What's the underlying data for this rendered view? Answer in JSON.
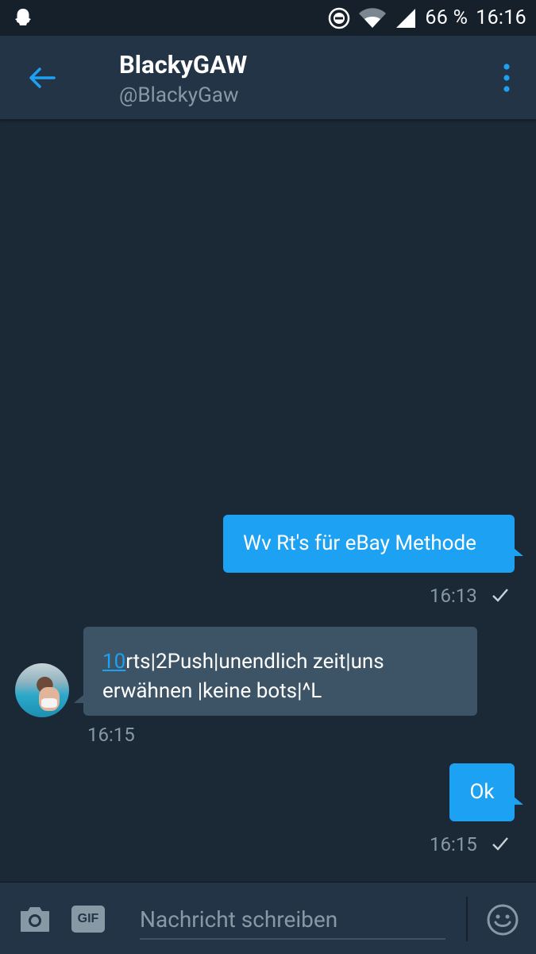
{
  "status_bar": {
    "battery": "66 %",
    "clock": "16:16"
  },
  "header": {
    "name": "BlackyGAW",
    "handle": "@BlackyGaw"
  },
  "messages": [
    {
      "direction": "outgoing",
      "text": "Wv Rt's für eBay Methode",
      "time": "16:13",
      "read": true
    },
    {
      "direction": "incoming",
      "link_text": "10",
      "text": "rts|2Push|unendlich zeit|uns erwähnen |keine bots|^L",
      "time": "16:15"
    },
    {
      "direction": "outgoing",
      "text": "Ok",
      "time": "16:15",
      "read": true
    }
  ],
  "composer": {
    "placeholder": "Nachricht schreiben",
    "gif_label": "GIF"
  },
  "colors": {
    "background": "#1b2836",
    "app_bar": "#243447",
    "accent": "#1da1f2",
    "incoming_bubble": "#3d5466",
    "muted_text": "#8899a6"
  }
}
